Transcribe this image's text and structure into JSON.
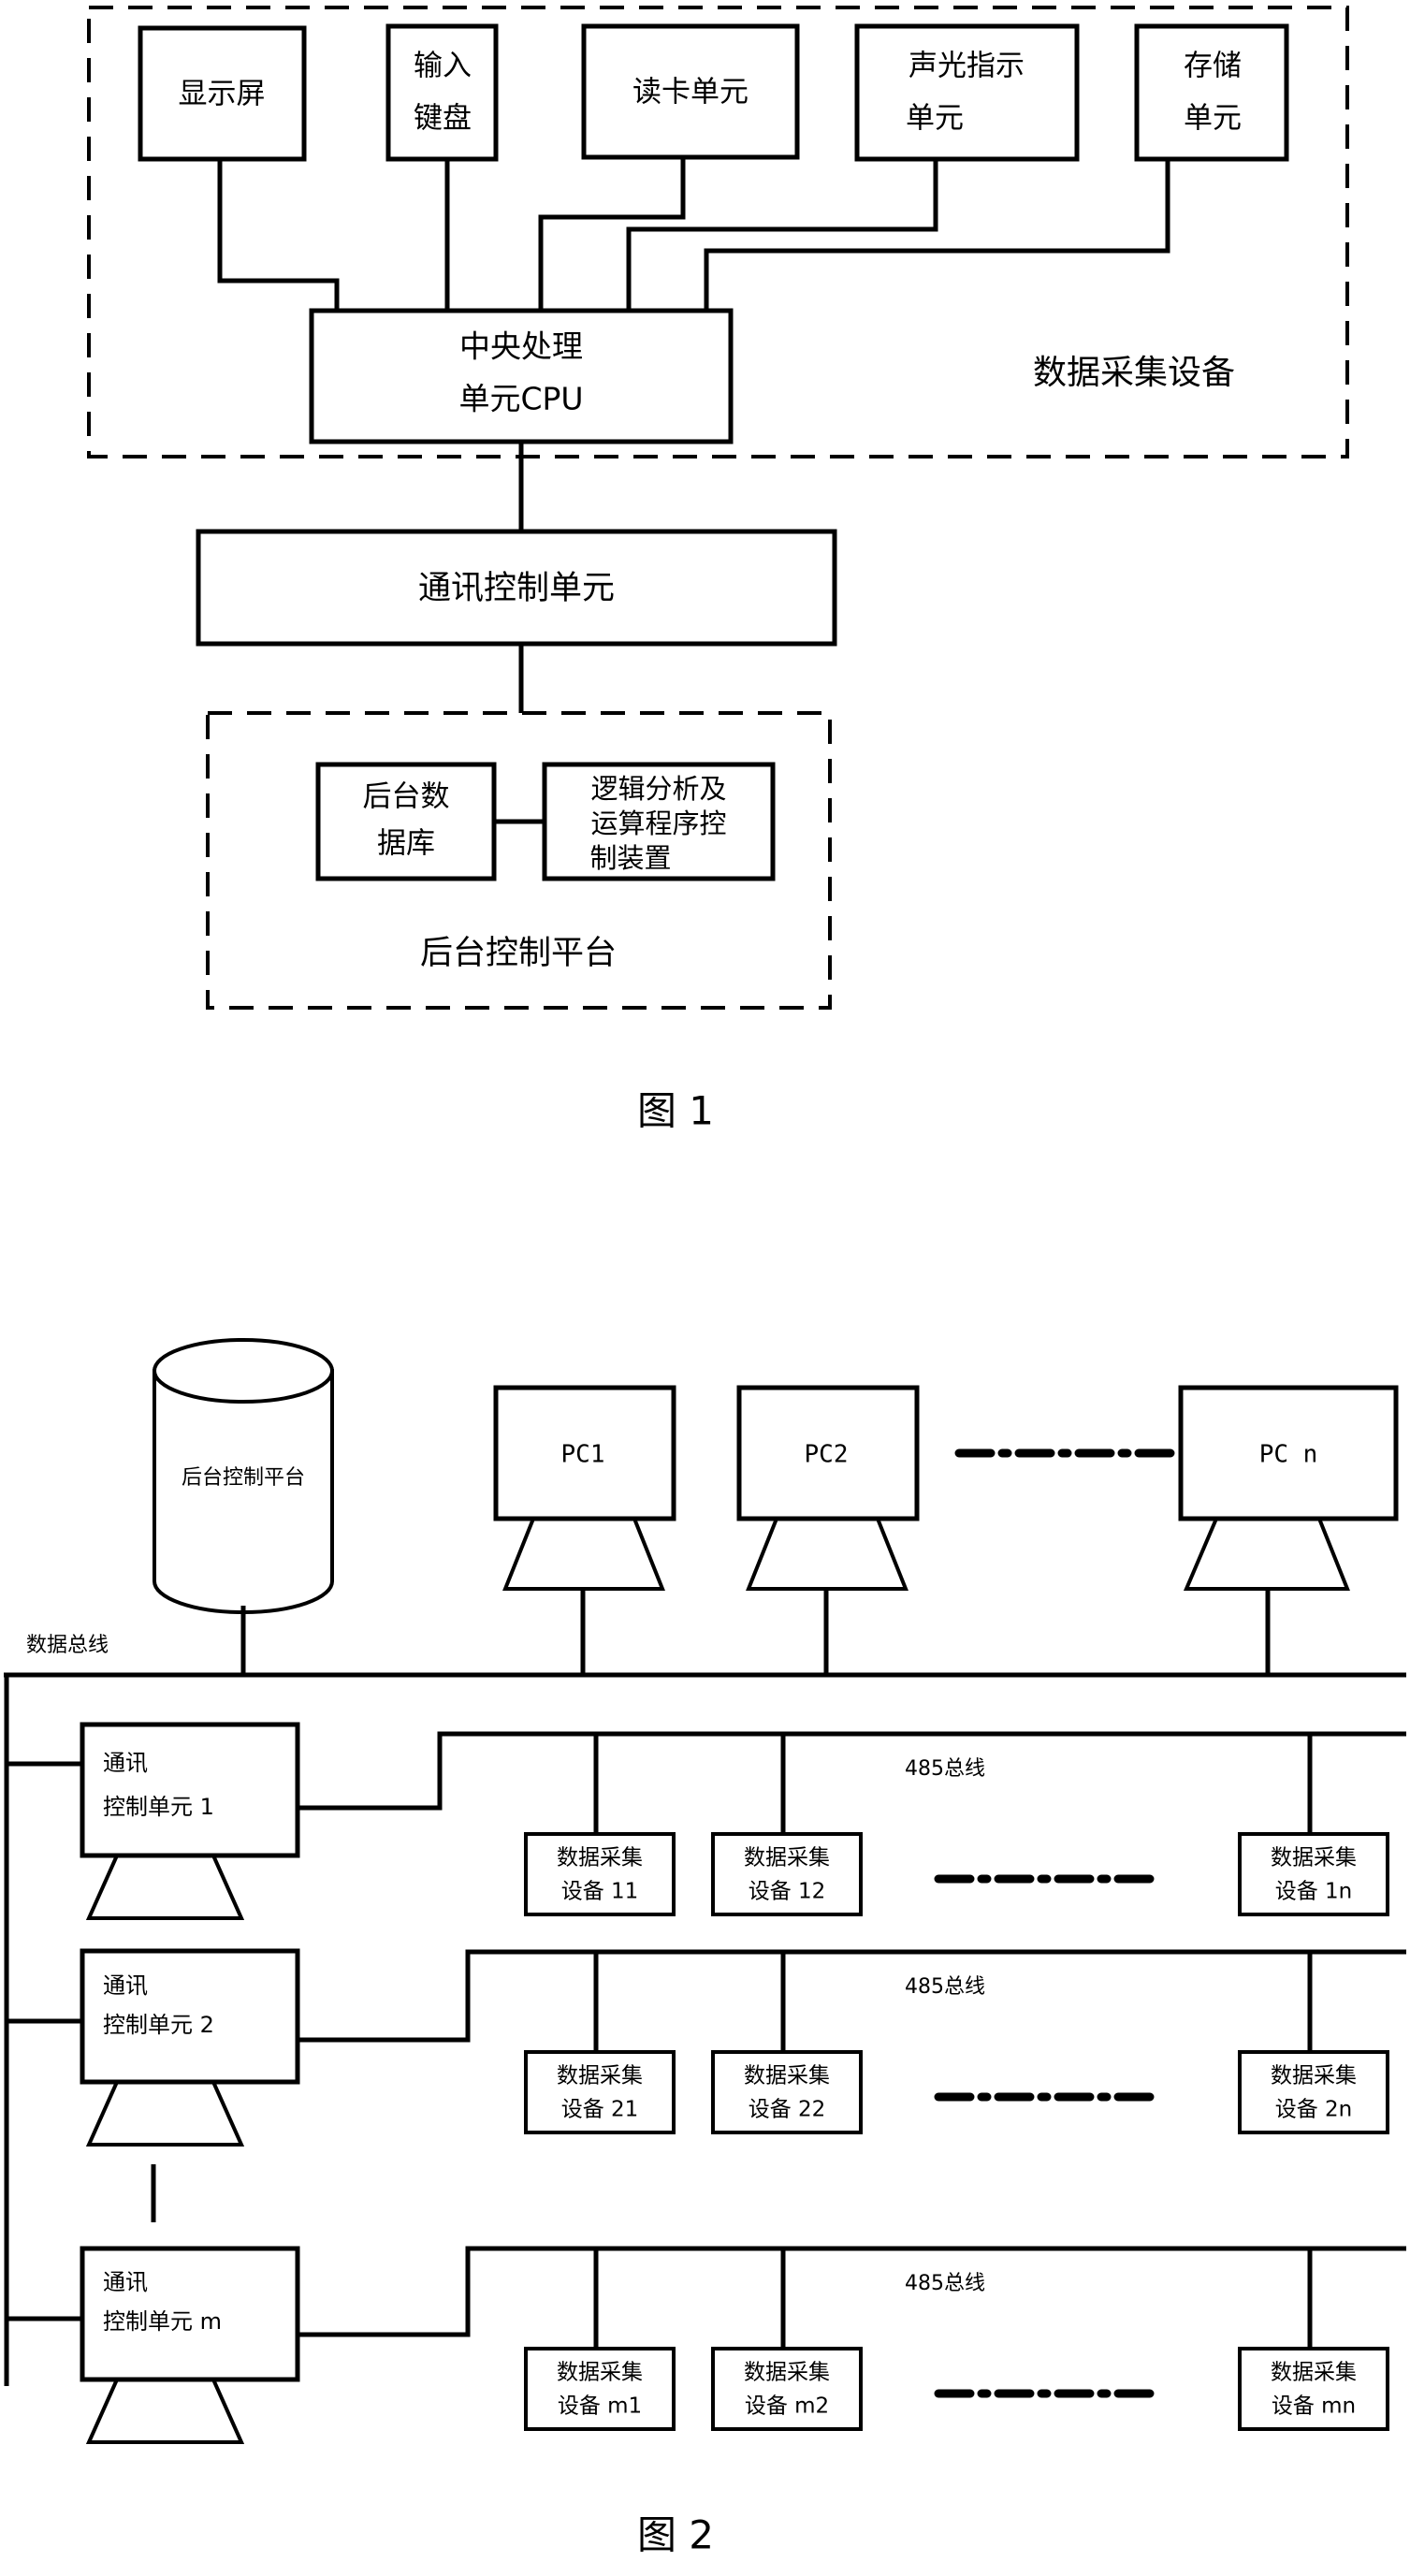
{
  "figure1": {
    "caption": "图  1",
    "group_label_top": "数据采集设备",
    "group_label_bottom": "后台控制平台",
    "boxes": {
      "display": "显示屏",
      "keyboard_l1": "输入",
      "keyboard_l2": "键盘",
      "card_reader": "读卡单元",
      "indicator_l1": "声光指示",
      "indicator_l2": "单元",
      "storage_l1": "存储",
      "storage_l2": "单元",
      "cpu_l1": "中央处理",
      "cpu_l2": "单元CPU",
      "comm_control": "通讯控制单元",
      "database_l1": "后台数",
      "database_l2": "据库",
      "logic_l1": "逻辑分析及",
      "logic_l2": "运算程序控",
      "logic_l3": "制装置"
    }
  },
  "figure2": {
    "caption": "图  2",
    "cylinder_label": "后台控制平台",
    "data_bus_label": "数据总线",
    "bus_485_label": "485总线",
    "pcs": [
      {
        "label": "PC1"
      },
      {
        "label": "PC2"
      },
      {
        "label": "PC n"
      }
    ],
    "rows": [
      {
        "unit_l1": "通讯",
        "unit_l2": "控制单元 1",
        "bus_label": "485总线",
        "devices": [
          {
            "l1": "数据采集",
            "l2": "设备 11"
          },
          {
            "l1": "数据采集",
            "l2": "设备 12"
          },
          {
            "l1": "数据采集",
            "l2": "设备 1n"
          }
        ]
      },
      {
        "unit_l1": "通讯",
        "unit_l2": "控制单元 2",
        "bus_label": "485总线",
        "devices": [
          {
            "l1": "数据采集",
            "l2": "设备 21"
          },
          {
            "l1": "数据采集",
            "l2": "设备 22"
          },
          {
            "l1": "数据采集",
            "l2": "设备 2n"
          }
        ]
      },
      {
        "unit_l1": "通讯",
        "unit_l2": "控制单元 m",
        "bus_label": "485总线",
        "devices": [
          {
            "l1": "数据采集",
            "l2": "设备 m1"
          },
          {
            "l1": "数据采集",
            "l2": "设备 m2"
          },
          {
            "l1": "数据采集",
            "l2": "设备 mn"
          }
        ]
      }
    ]
  },
  "colors": {
    "ink": "#000000",
    "paper": "#ffffff"
  }
}
